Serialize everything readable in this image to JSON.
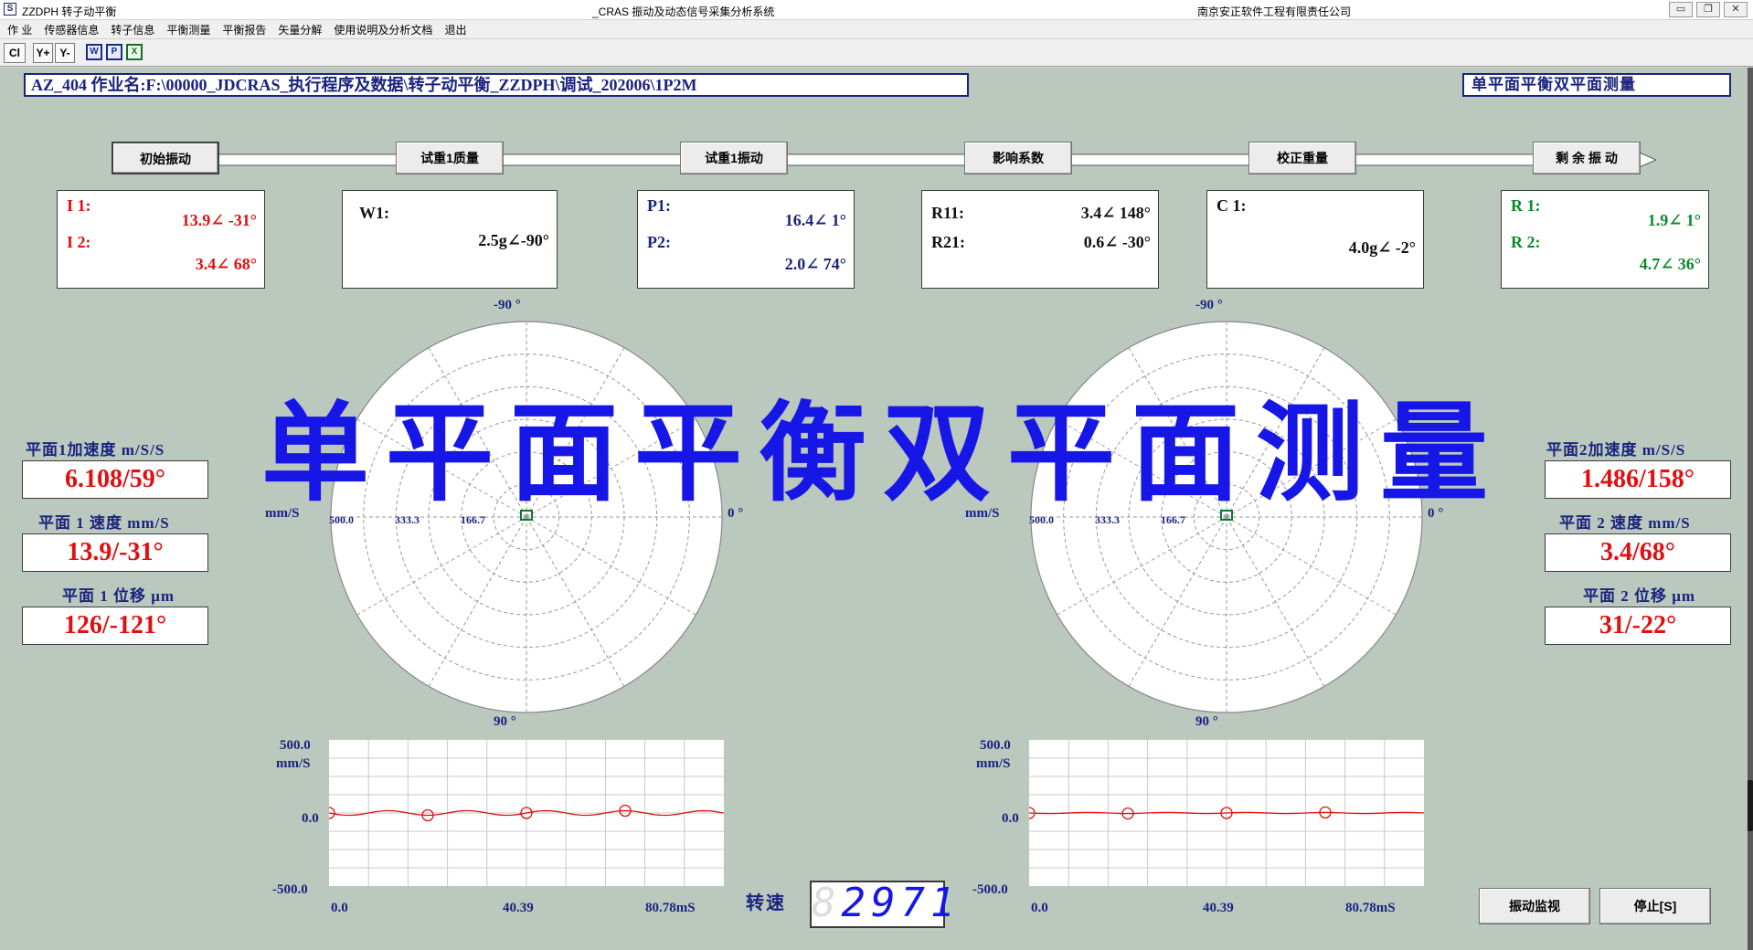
{
  "window": {
    "title_left": "ZZDPH 转子动平衡",
    "title_center": "_CRAS 振动及动态信号采集分析系统",
    "title_right": "南京安正软件工程有限责任公司",
    "app_icon": "S",
    "minimize": "▭",
    "restore": "❐",
    "close": "✕"
  },
  "menu": [
    "作 业",
    "传感器信息",
    "转子信息",
    "平衡测量",
    "平衡报告",
    "矢量分解",
    "使用说明及分析文档",
    "退出"
  ],
  "toolbar": {
    "cl": "Cl",
    "y_plus": "Y+",
    "y_minus": "Y-",
    "w": "W",
    "p": "P",
    "x": "X"
  },
  "path_text": "AZ_404 作业名:F:\\00000_JDCRAS_执行程序及数据\\转子动平衡_ZZDPH\\调试_202006\\1P2M",
  "mode_title": "单平面平衡双平面测量",
  "steps": [
    "初始振动",
    "试重1质量",
    "试重1振动",
    "影响系数",
    "校正重量",
    "剩 余 振 动"
  ],
  "boxes": {
    "initial": {
      "l1": "I 1:",
      "v1": "13.9∠ -31°",
      "l2": "I 2:",
      "v2": "3.4∠ 68°"
    },
    "trial_weight": {
      "l1": "W1:",
      "v1": "2.5g∠-90°"
    },
    "trial_vib": {
      "l1": "P1:",
      "v1": "16.4∠ 1°",
      "l2": "P2:",
      "v2": "2.0∠ 74°"
    },
    "influence": {
      "l1": "R11:",
      "v1": "3.4∠ 148°",
      "l2": "R21:",
      "v2": "0.6∠ -30°"
    },
    "correction": {
      "l1": "C 1:",
      "v1": "4.0g∠ -2°"
    },
    "residual": {
      "l1": "R 1:",
      "v1": "1.9∠ 1°",
      "l2": "R 2:",
      "v2": "4.7∠ 36°"
    }
  },
  "polar": {
    "top": "-90 °",
    "bottom": "90 °",
    "right": "0 °",
    "unit": "mm/S",
    "r_ticks": [
      "500.0",
      "333.3",
      "166.7"
    ]
  },
  "left_panel": {
    "acc_label": "平面1加速度 m/S/S",
    "acc_value": "6.108/59°",
    "vel_label": "平面 1 速度 mm/S",
    "vel_value": "13.9/-31°",
    "disp_label": "平面 1 位移 μm",
    "disp_value": "126/-121°"
  },
  "right_panel": {
    "acc_label": "平面2加速度 m/S/S",
    "acc_value": "1.486/158°",
    "vel_label": "平面 2 速度 mm/S",
    "vel_value": "3.4/68°",
    "disp_label": "平面 2 位移 μm",
    "disp_value": "31/-22°"
  },
  "wave": {
    "y_top": "500.0",
    "y_unit": "mm/S",
    "y_zero": "0.0",
    "y_bottom": "-500.0",
    "x_labels": [
      "0.0",
      "40.39",
      "80.78mS"
    ]
  },
  "big_title": "单平面平衡双平面测量",
  "speed": {
    "label": "转速",
    "ghost": "8",
    "value": "2971"
  },
  "buttons": {
    "monitor": "振动监视",
    "stop": "停止[S]"
  }
}
